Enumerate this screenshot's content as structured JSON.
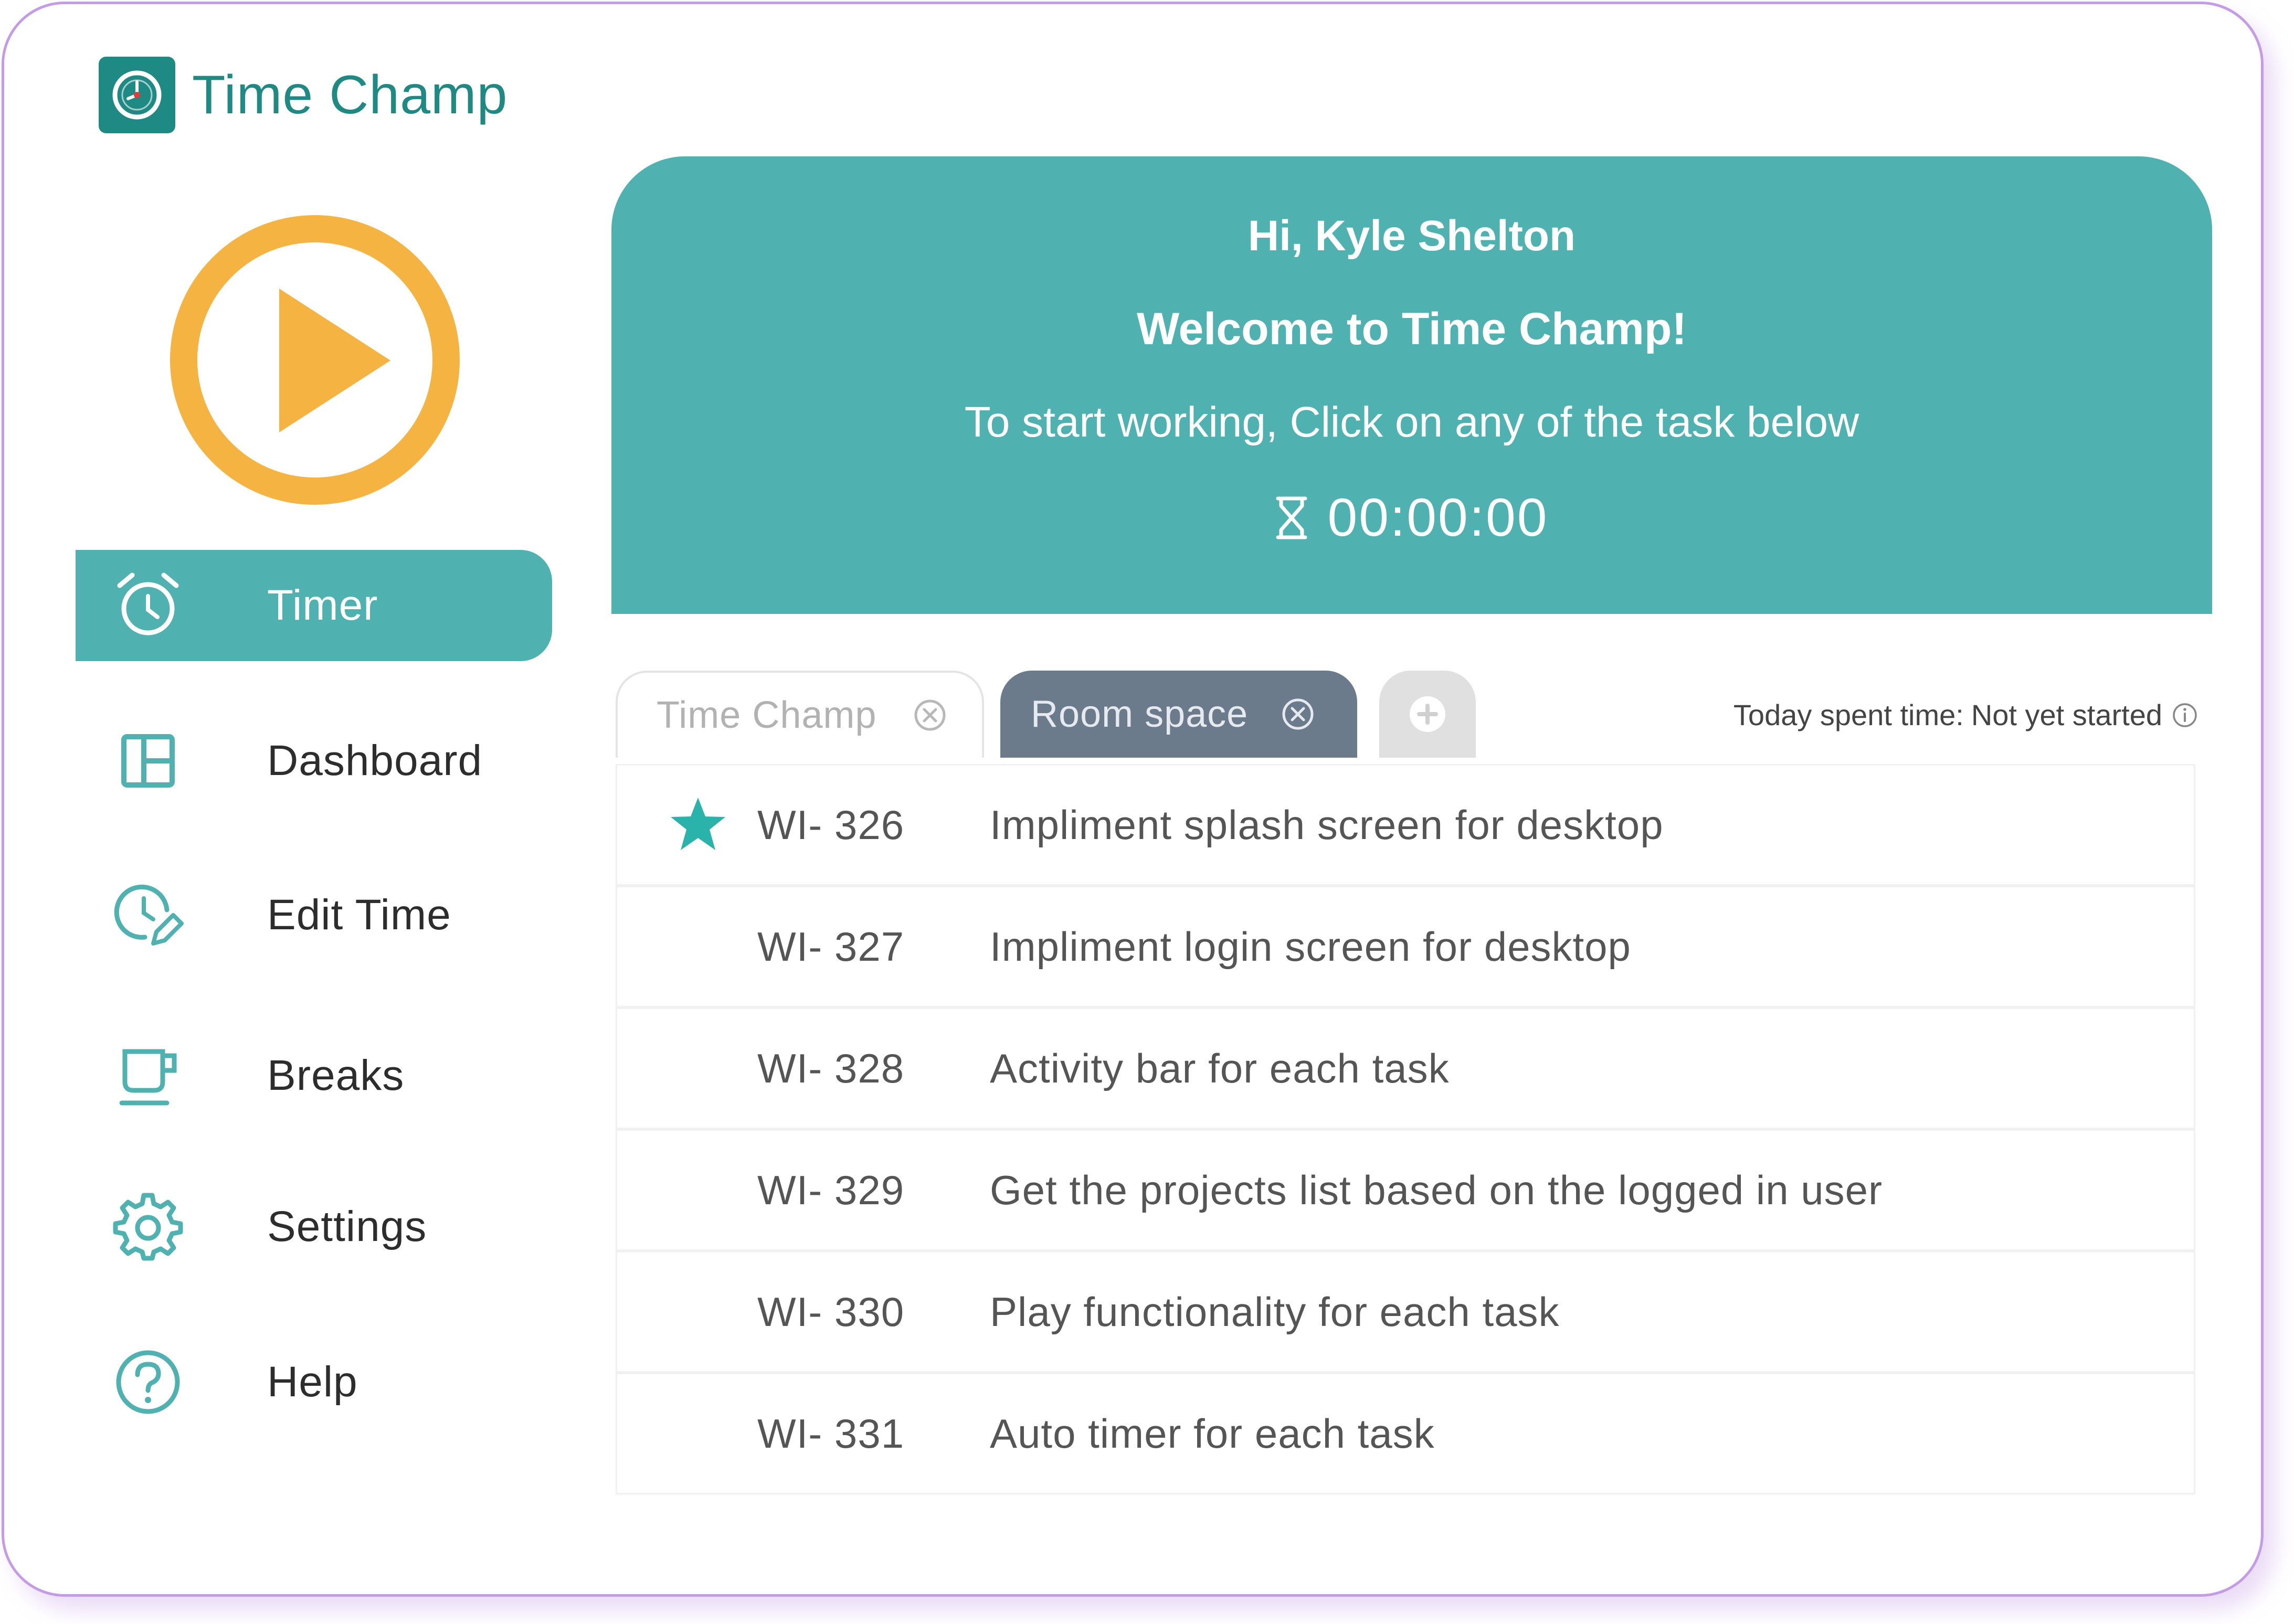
{
  "app": {
    "name": "Time Champ"
  },
  "colors": {
    "accent": "#4fb2b0",
    "brand": "#1f8a84",
    "play": "#f5b342",
    "active_tab": "#6b7b8c",
    "frame": "#c49be6"
  },
  "sidebar": {
    "items": [
      {
        "label": "Timer",
        "icon": "alarm-clock-icon",
        "active": true
      },
      {
        "label": "Dashboard",
        "icon": "dashboard-icon",
        "active": false
      },
      {
        "label": "Edit Time",
        "icon": "clock-edit-icon",
        "active": false
      },
      {
        "label": "Breaks",
        "icon": "coffee-cup-icon",
        "active": false
      },
      {
        "label": "Settings",
        "icon": "gear-icon",
        "active": false
      },
      {
        "label": "Help",
        "icon": "help-icon",
        "active": false
      }
    ]
  },
  "banner": {
    "greeting": "Hi, Kyle Shelton",
    "welcome": "Welcome to Time Champ!",
    "instruction": "To start working, Click on any of the task below",
    "timer": "00:00:00"
  },
  "tabs": [
    {
      "label": "Time Champ",
      "active": false
    },
    {
      "label": "Room space",
      "active": true
    }
  ],
  "status": {
    "spent_label": "Today spent time:",
    "spent_value": "Not yet started"
  },
  "tasks": [
    {
      "id": "WI- 326",
      "title": "Impliment splash screen for desktop",
      "starred": true
    },
    {
      "id": "WI- 327",
      "title": "Impliment login screen for desktop",
      "starred": false
    },
    {
      "id": "WI- 328",
      "title": "Activity bar for each task",
      "starred": false
    },
    {
      "id": "WI- 329",
      "title": "Get the projects list based on the logged in user",
      "starred": false
    },
    {
      "id": "WI- 330",
      "title": "Play functionality for each task",
      "starred": false
    },
    {
      "id": "WI- 331",
      "title": "Auto timer for each task",
      "starred": false
    }
  ]
}
